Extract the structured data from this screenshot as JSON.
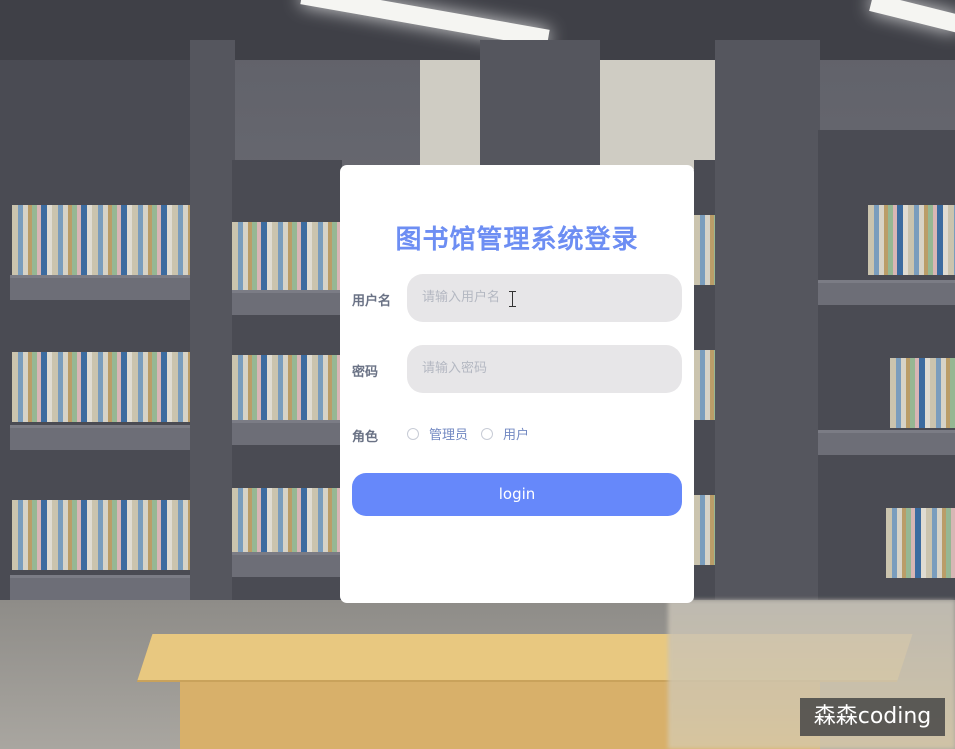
{
  "login": {
    "title": "图书馆管理系统登录",
    "username_label": "用户名",
    "username_placeholder": "请输入用户名",
    "username_value": "",
    "password_label": "密码",
    "password_placeholder": "请输入密码",
    "password_value": "",
    "role_label": "角色",
    "roles": [
      {
        "label": "管理员",
        "checked": false
      },
      {
        "label": "用户",
        "checked": false
      }
    ],
    "submit_label": "login"
  },
  "watermark": "森森coding",
  "colors": {
    "accent": "#6688fa",
    "title": "#6d8ef3",
    "input_bg": "#e7e6e8",
    "card_bg": "#ffffff"
  },
  "icons": {
    "text_cursor": "i-beam-cursor-icon"
  }
}
